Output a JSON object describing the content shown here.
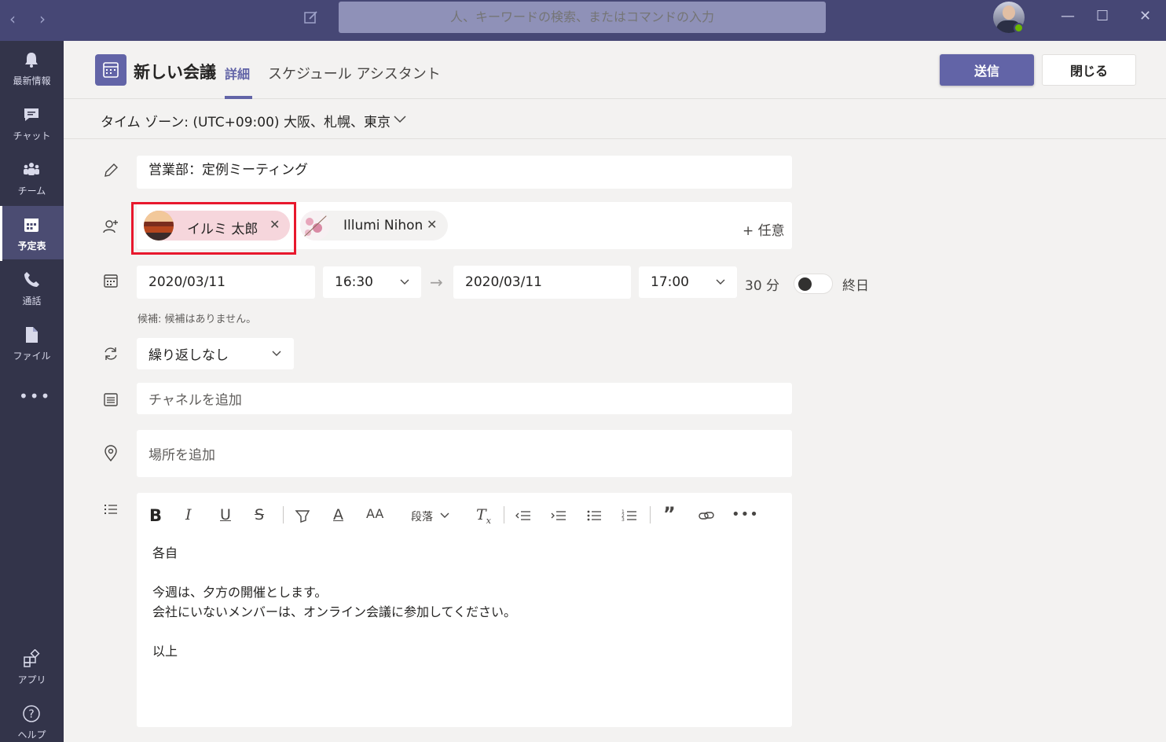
{
  "search": {
    "placeholder": "人、キーワードの検索、またはコマンドの入力"
  },
  "rail": {
    "items": [
      {
        "label": "最新情報",
        "icon": "bell-icon"
      },
      {
        "label": "チャット",
        "icon": "chat-icon"
      },
      {
        "label": "チーム",
        "icon": "teams-icon"
      },
      {
        "label": "予定表",
        "icon": "calendar-icon"
      },
      {
        "label": "通話",
        "icon": "phone-icon"
      },
      {
        "label": "ファイル",
        "icon": "file-icon"
      }
    ],
    "more": "•••",
    "bottom": [
      {
        "label": "アプリ",
        "icon": "apps-icon"
      },
      {
        "label": "ヘルプ",
        "icon": "help-icon"
      }
    ]
  },
  "header": {
    "title": "新しい会議",
    "tabs": [
      "詳細",
      "スケジュール アシスタント"
    ],
    "send": "送信",
    "close": "閉じる"
  },
  "timezone": {
    "label": "タイム ゾーン: (UTC+09:00) 大阪、札幌、東京"
  },
  "form": {
    "title": "営業部：定例ミーティング",
    "attendees": [
      {
        "name": "イルミ 太郎"
      },
      {
        "name": "Illumi Nihon"
      }
    ],
    "optional": "+ 任意",
    "start_date": "2020/03/11",
    "start_time": "16:30",
    "end_date": "2020/03/11",
    "end_time": "17:00",
    "duration": "30 分",
    "all_day": "終日",
    "all_day_on": false,
    "hint": "候補: 候補はありません。",
    "repeat": "繰り返しなし",
    "channel_placeholder": "チャネルを追加",
    "location_placeholder": "場所を追加"
  },
  "editor": {
    "paragraph_label": "段落",
    "body": [
      "各自",
      "",
      "今週は、夕方の開催とします。",
      "会社にいないメンバーは、オンライン会議に参加してください。",
      "",
      "以上"
    ]
  },
  "colors": {
    "accent": "#6264a7",
    "titlebar": "#464775",
    "rail": "#33344a",
    "highlight": "#e8182d"
  }
}
